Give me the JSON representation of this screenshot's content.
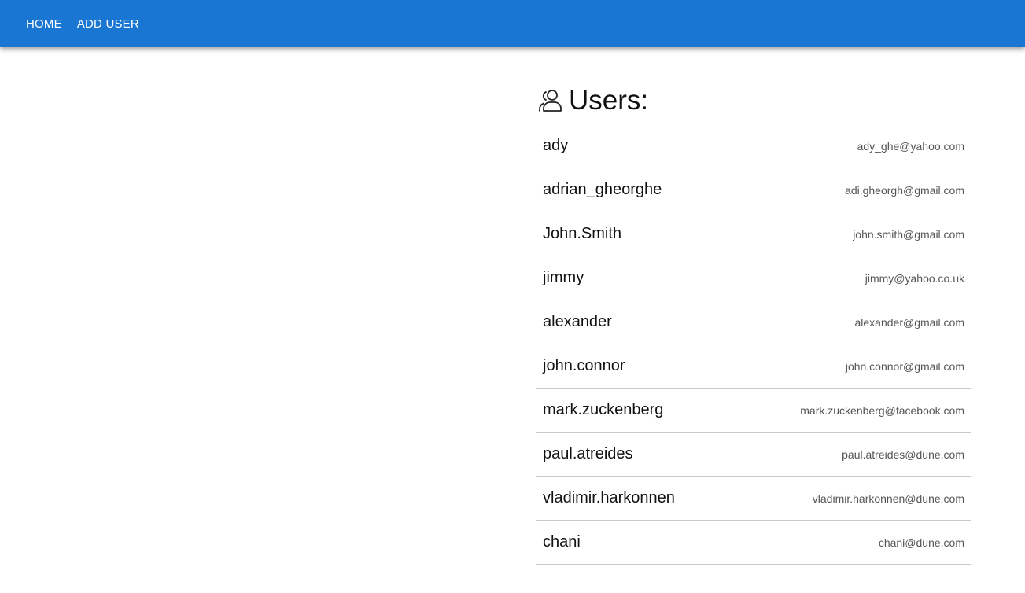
{
  "nav": {
    "home_label": "HOME",
    "add_user_label": "ADD USER"
  },
  "users_section": {
    "icon": "users-icon",
    "title": "Users:"
  },
  "users": [
    {
      "username": "ady",
      "email": "ady_ghe@yahoo.com"
    },
    {
      "username": "adrian_gheorghe",
      "email": "adi.gheorgh@gmail.com"
    },
    {
      "username": "John.Smith",
      "email": "john.smith@gmail.com"
    },
    {
      "username": "jimmy",
      "email": "jimmy@yahoo.co.uk"
    },
    {
      "username": "alexander",
      "email": "alexander@gmail.com"
    },
    {
      "username": "john.connor",
      "email": "john.connor@gmail.com"
    },
    {
      "username": "mark.zuckenberg",
      "email": "mark.zuckenberg@facebook.com"
    },
    {
      "username": "paul.atreides",
      "email": "paul.atreides@dune.com"
    },
    {
      "username": "vladimir.harkonnen",
      "email": "vladimir.harkonnen@dune.com"
    },
    {
      "username": "chani",
      "email": "chani@dune.com"
    }
  ],
  "colors": {
    "appbar": "#1976d2",
    "divider": "#c8c8c8"
  }
}
